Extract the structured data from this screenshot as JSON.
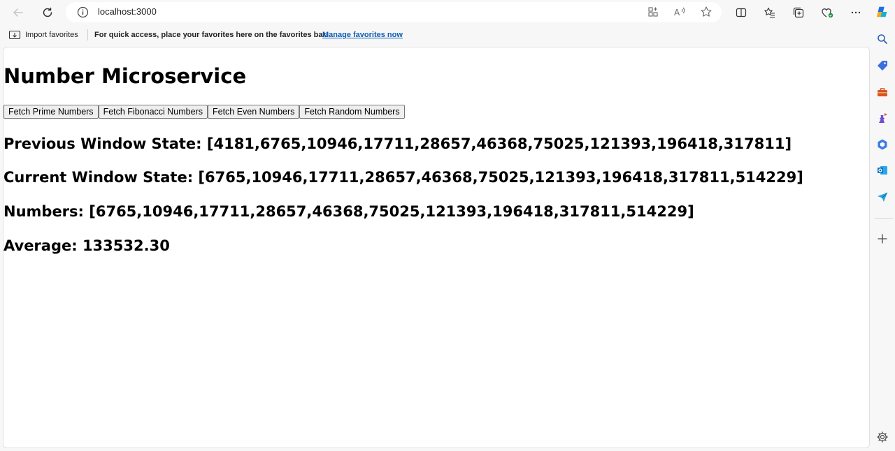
{
  "browser": {
    "url": "localhost:3000",
    "favorites_bar": {
      "import_label": "Import favorites",
      "message": "For quick access, place your favorites here on the favorites bar.",
      "link": "Manage favorites now"
    }
  },
  "page": {
    "title": "Number Microservice",
    "buttons": [
      "Fetch Prime Numbers",
      "Fetch Fibonacci Numbers",
      "Fetch Even Numbers",
      "Fetch Random Numbers"
    ],
    "prev_state": "Previous Window State: [4181,6765,10946,17711,28657,46368,75025,121393,196418,317811]",
    "curr_state": "Current Window State: [6765,10946,17711,28657,46368,75025,121393,196418,317811,514229]",
    "numbers": "Numbers: [6765,10946,17711,28657,46368,75025,121393,196418,317811,514229]",
    "average": "Average: 133532.30"
  },
  "icons": {
    "back": "back-arrow-icon",
    "reload": "reload-icon",
    "info": "info-icon",
    "sidebar": [
      "copilot-icon",
      "search-icon",
      "shopping-tag-icon",
      "tools-icon",
      "games-icon",
      "m365-icon",
      "outlook-icon",
      "send-icon",
      "add-icon",
      "settings-icon"
    ]
  },
  "colors": {
    "link": "#0c5eb3",
    "page_bg": "#ffffff",
    "chrome_bg": "#f7f7f7"
  }
}
